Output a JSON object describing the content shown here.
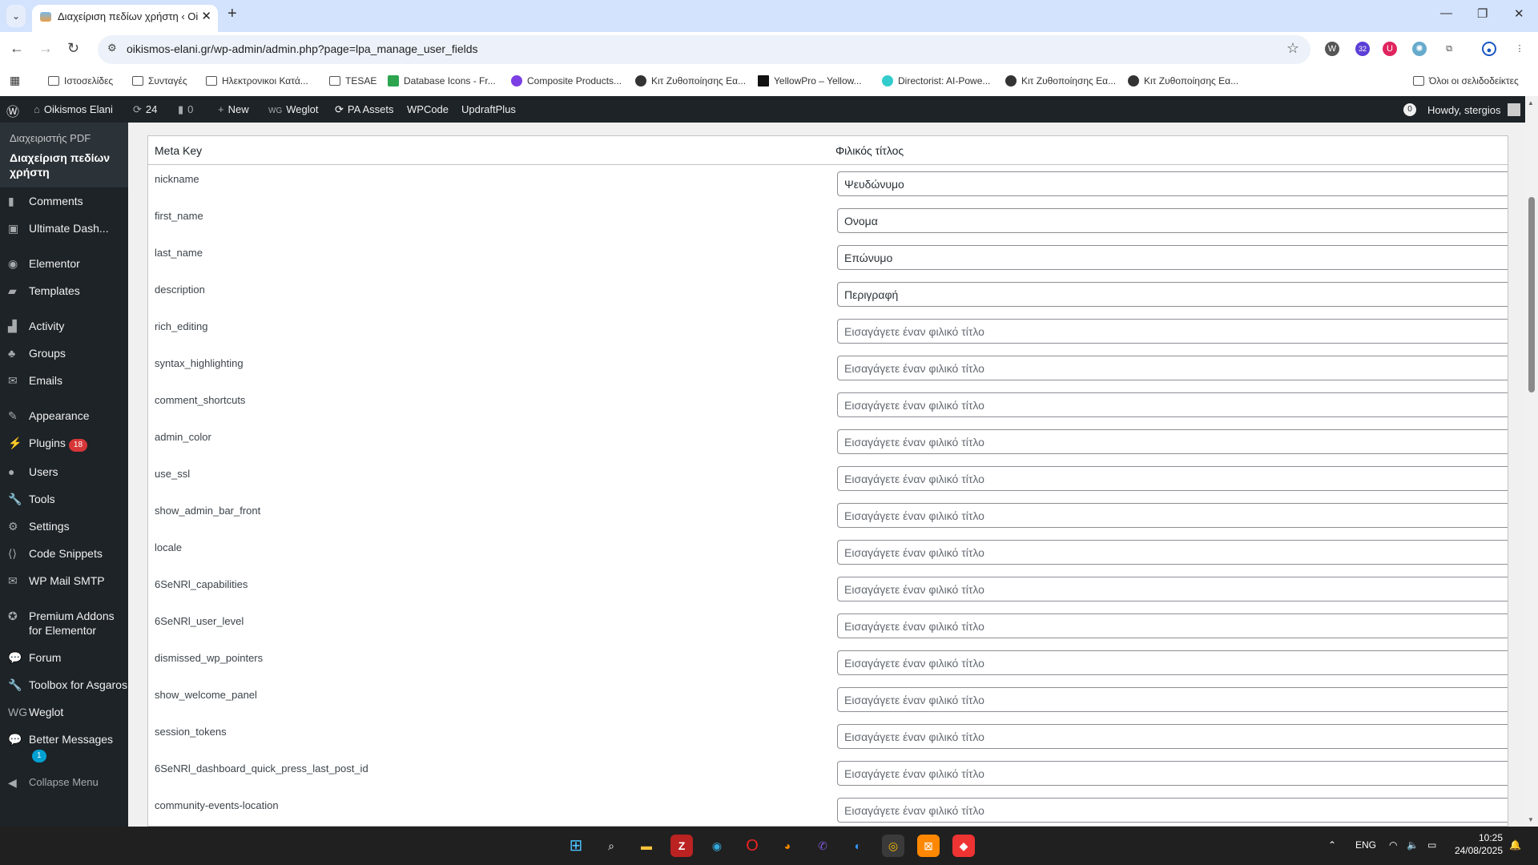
{
  "browser": {
    "tab_title": "Διαχείριση πεδίων χρήστη ‹ Oi",
    "url": "oikismos-elani.gr/wp-admin/admin.php?page=lpa_manage_user_fields",
    "ext_badge": "32",
    "bookmarks": [
      "Ιστοσελίδες",
      "Συνταγές",
      "Ηλεκτρονικοι Κατά...",
      "TESAE",
      "Database Icons - Fr...",
      "Composite Products...",
      "Κιτ Ζυθοποίησης Εα...",
      "YellowPro – Yellow...",
      "Directorist: AI-Powe...",
      "Κιτ Ζυθοποίησης Εα...",
      "Κιτ Ζυθοποίησης Εα..."
    ],
    "all_bookmarks": "Όλοι οι σελιδοδείκτες"
  },
  "adminbar": {
    "site": "Oikismos Elani",
    "updates": "24",
    "comments": "0",
    "new": "New",
    "weglot": "Weglot",
    "pa_assets": "PA Assets",
    "wpcode": "WPCode",
    "updraft": "UpdraftPlus",
    "notif": "0",
    "howdy": "Howdy, stergios"
  },
  "sidebar": {
    "sub_parent": "Διαχειριστής PDF",
    "sub_current": "Διαχείριση πεδίων χρήστη",
    "items": [
      {
        "label": "Comments",
        "icon": "comment-icon",
        "ic": "▮"
      },
      {
        "label": "Ultimate Dash...",
        "icon": "dashboard-icon",
        "ic": "▣"
      },
      {
        "label": "Elementor",
        "icon": "elementor-icon",
        "ic": "◉",
        "sep": true
      },
      {
        "label": "Templates",
        "icon": "folder-icon",
        "ic": "▰"
      },
      {
        "label": "Activity",
        "icon": "activity-icon",
        "ic": "▟",
        "sep": true
      },
      {
        "label": "Groups",
        "icon": "groups-icon",
        "ic": "♣"
      },
      {
        "label": "Emails",
        "icon": "mail-icon",
        "ic": "✉"
      },
      {
        "label": "Appearance",
        "icon": "brush-icon",
        "ic": "✎",
        "sep": true
      },
      {
        "label": "Plugins",
        "icon": "plugin-icon",
        "ic": "⚡",
        "badge": "18"
      },
      {
        "label": "Users",
        "icon": "user-icon",
        "ic": "●"
      },
      {
        "label": "Tools",
        "icon": "wrench-icon",
        "ic": "🔧"
      },
      {
        "label": "Settings",
        "icon": "settings-icon",
        "ic": "⚙"
      },
      {
        "label": "Code Snippets",
        "icon": "code-icon",
        "ic": "⟨⟩"
      },
      {
        "label": "WP Mail SMTP",
        "icon": "mail-arrow-icon",
        "ic": "✉"
      },
      {
        "label": "Premium Addons for Elementor",
        "icon": "star-icon",
        "ic": "✪",
        "sep": true
      },
      {
        "label": "Forum",
        "icon": "forum-icon",
        "ic": "💬"
      },
      {
        "label": "Toolbox for Asgaros",
        "icon": "wrench-icon",
        "ic": "🔧"
      },
      {
        "label": "Weglot",
        "icon": "weglot-icon",
        "ic": "WG"
      },
      {
        "label": "Better Messages",
        "icon": "messages-icon",
        "ic": "💬",
        "badge": "1",
        "badge_color": "blue"
      }
    ],
    "collapse": "Collapse Menu"
  },
  "table": {
    "col_key": "Meta Key",
    "col_title": "Φιλικός τίτλος",
    "placeholder": "Εισαγάγετε έναν φιλικό τίτλο",
    "rows": [
      {
        "key": "nickname",
        "value": "Ψευδώνυμο"
      },
      {
        "key": "first_name",
        "value": "Ονομα"
      },
      {
        "key": "last_name",
        "value": "Επώνυμο"
      },
      {
        "key": "description",
        "value": "Περιγραφή"
      },
      {
        "key": "rich_editing",
        "value": ""
      },
      {
        "key": "syntax_highlighting",
        "value": ""
      },
      {
        "key": "comment_shortcuts",
        "value": ""
      },
      {
        "key": "admin_color",
        "value": ""
      },
      {
        "key": "use_ssl",
        "value": ""
      },
      {
        "key": "show_admin_bar_front",
        "value": ""
      },
      {
        "key": "locale",
        "value": ""
      },
      {
        "key": "6SeNRl_capabilities",
        "value": ""
      },
      {
        "key": "6SeNRl_user_level",
        "value": ""
      },
      {
        "key": "dismissed_wp_pointers",
        "value": ""
      },
      {
        "key": "show_welcome_panel",
        "value": ""
      },
      {
        "key": "session_tokens",
        "value": ""
      },
      {
        "key": "6SeNRl_dashboard_quick_press_last_post_id",
        "value": ""
      },
      {
        "key": "community-events-location",
        "value": ""
      }
    ]
  },
  "taskbar": {
    "lang": "ENG",
    "time": "10:25",
    "date": "24/08/2025"
  }
}
